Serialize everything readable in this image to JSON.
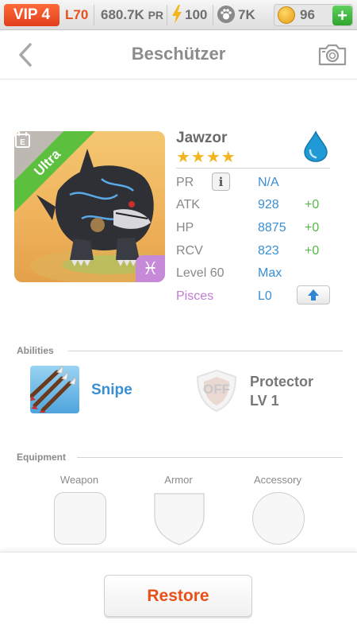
{
  "status_bar": {
    "vip": "VIP 4",
    "level": "L70",
    "power": "680.7K",
    "power_unit": "PR",
    "stamina": "100",
    "paws": "7K",
    "coins": "96",
    "add_label": "+"
  },
  "header": {
    "title": "Beschützer"
  },
  "pet": {
    "name": "Jawzor",
    "stars": "★★★★",
    "rarity": "Ultra",
    "element": "water-icon",
    "zodiac_symbol": "♓",
    "stats": [
      {
        "label": "PR",
        "value": "N/A",
        "bonus": ""
      },
      {
        "label": "ATK",
        "value": "928",
        "bonus": "+0"
      },
      {
        "label": "HP",
        "value": "8875",
        "bonus": "+0"
      },
      {
        "label": "RCV",
        "value": "823",
        "bonus": "+0"
      },
      {
        "label": "Level 60",
        "value": "Max",
        "bonus": ""
      },
      {
        "label": "Pisces",
        "value": "L0",
        "bonus": ""
      }
    ],
    "info_label": "i"
  },
  "abilities": {
    "title": "Abilities",
    "active": {
      "name": "Snipe"
    },
    "passive": {
      "state": "OFF",
      "name": "Protector",
      "level": "LV 1"
    }
  },
  "equipment": {
    "title": "Equipment",
    "slots": [
      {
        "label": "Weapon"
      },
      {
        "label": "Armor"
      },
      {
        "label": "Accessory"
      }
    ]
  },
  "footer": {
    "restore_label": "Restore"
  },
  "colors": {
    "accent_orange": "#e8501a",
    "stat_blue": "#3a8fd3",
    "bonus_green": "#55b748",
    "pisces_purple": "#c27ad4",
    "ultra_green": "#5cbf3e"
  }
}
